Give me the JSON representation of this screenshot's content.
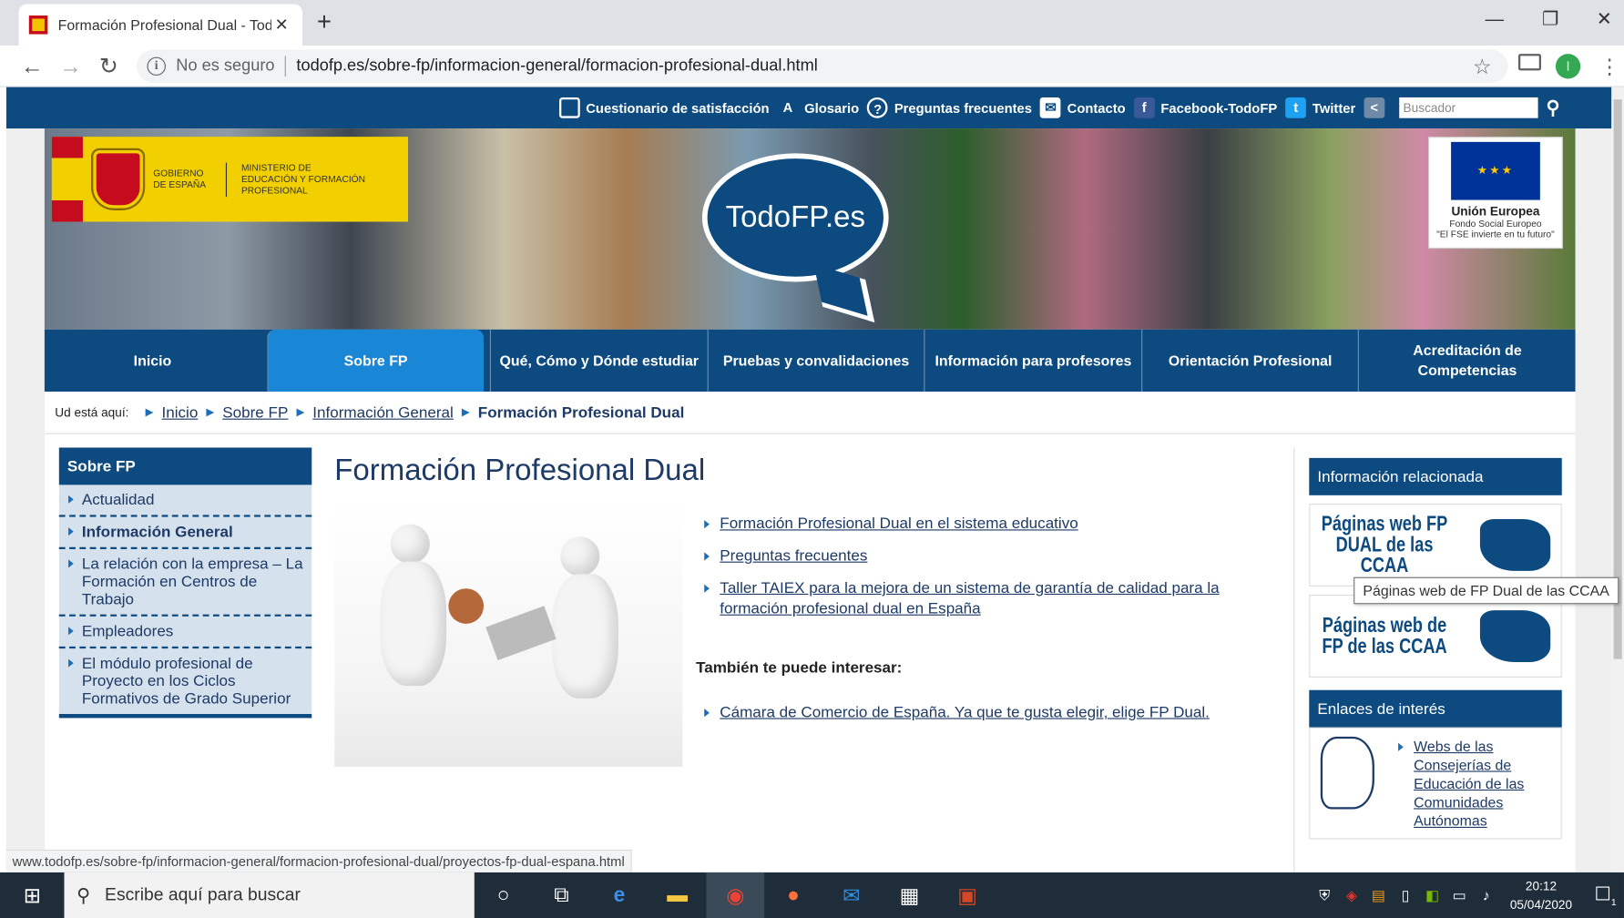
{
  "browser": {
    "tab_title": "Formación Profesional Dual - Tod",
    "tab_close": "✕",
    "new_tab": "+",
    "window_controls": {
      "minimize": "—",
      "restore": "❐",
      "close": "✕"
    },
    "nav": {
      "back": "←",
      "forward": "→",
      "reload": "↻"
    },
    "security_label": "No es seguro",
    "url": "todofp.es/sobre-fp/informacion-general/formacion-profesional-dual.html",
    "profile_initial": "I",
    "status_url": "www.todofp.es/sobre-fp/informacion-general/formacion-profesional-dual/proyectos-fp-dual-espana.html"
  },
  "topbar": {
    "links": [
      {
        "label": "Cuestionario de satisfacción",
        "icon": "clipboard-icon"
      },
      {
        "label": "Glosario",
        "icon": "az-icon"
      },
      {
        "label": "Preguntas frecuentes",
        "icon": "question-icon"
      },
      {
        "label": "Contacto",
        "icon": "mail-icon"
      },
      {
        "label": "Facebook-TodoFP",
        "icon": "facebook-icon"
      },
      {
        "label": "Twitter",
        "icon": "twitter-icon"
      }
    ],
    "search_placeholder": "Buscador"
  },
  "banner": {
    "gov_line1": "GOBIERNO DE ESPAÑA",
    "gov_line2": "MINISTERIO DE EDUCACIÓN Y FORMACIÓN PROFESIONAL",
    "logo_text": "TodoFP.es",
    "eu_title": "Unión Europea",
    "eu_line1": "Fondo Social Europeo",
    "eu_line2": "\"El FSE invierte en tu futuro\""
  },
  "mainnav": [
    {
      "label": "Inicio",
      "active": false
    },
    {
      "label": "Sobre FP",
      "active": true
    },
    {
      "label": "Qué, Cómo y Dónde estudiar",
      "active": false
    },
    {
      "label": "Pruebas y convalidaciones",
      "active": false
    },
    {
      "label": "Información para profesores",
      "active": false
    },
    {
      "label": "Orientación Profesional",
      "active": false
    },
    {
      "label": "Acreditación de Competencias",
      "active": false
    }
  ],
  "breadcrumb": {
    "label": "Ud está aquí:",
    "items": [
      "Inicio",
      "Sobre FP",
      "Información General"
    ],
    "current": "Formación Profesional Dual"
  },
  "sidebar": {
    "title": "Sobre FP",
    "items": [
      {
        "label": "Actualidad"
      },
      {
        "label": "Información General",
        "selected": true
      },
      {
        "label": "La relación con la empresa – La Formación en Centros de Trabajo"
      },
      {
        "label": "Empleadores"
      },
      {
        "label": "El módulo profesional de Proyecto en los Ciclos Formativos de Grado Superior"
      }
    ]
  },
  "main": {
    "title": "Formación Profesional Dual",
    "links": [
      "Formación Profesional Dual en el sistema educativo",
      "Preguntas frecuentes",
      "Taller TAIEX para la mejora de un sistema de garantía de calidad para la formación profesional dual en España"
    ],
    "also_title": "También te puede interesar:",
    "also_links": [
      "Cámara de Comercio de España. Ya que te gusta elegir, elige FP Dual."
    ]
  },
  "right": {
    "related_title": "Información relacionada",
    "box1": "Páginas web FP DUAL de las CCAA",
    "box2": "Páginas web de FP de las CCAA",
    "interest_title": "Enlaces de interés",
    "interest_link": "Webs de las Consejerías de Educación de las Comunidades Autónomas",
    "tooltip": "Páginas web de FP Dual de las CCAA"
  },
  "taskbar": {
    "search_placeholder": "Escribe aquí para buscar",
    "time": "20:12",
    "date": "05/04/2020",
    "notification_count": "1"
  }
}
